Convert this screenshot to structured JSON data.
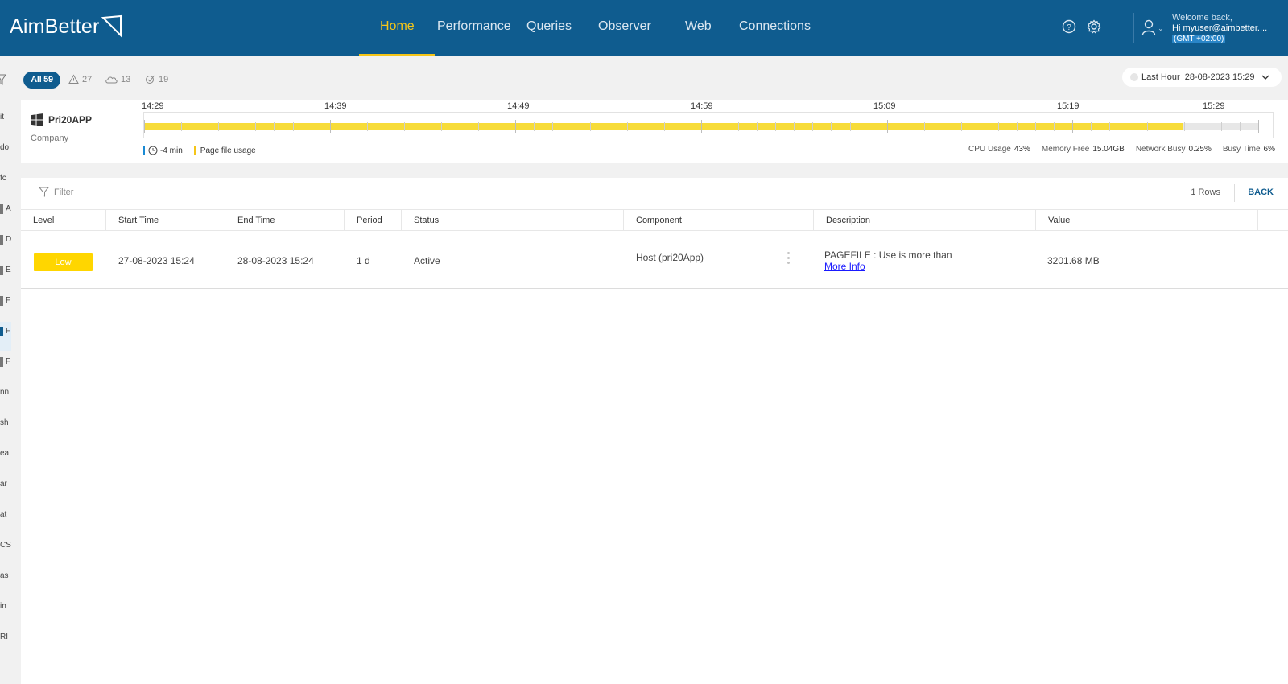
{
  "brand": {
    "name": "AimBetter"
  },
  "nav": {
    "items": [
      {
        "label": "Home",
        "active": true
      },
      {
        "label": "Performance"
      },
      {
        "label": "Queries"
      },
      {
        "label": "Observer"
      },
      {
        "label": "Web"
      },
      {
        "label": "Connections"
      }
    ]
  },
  "user": {
    "welcome": "Welcome back,",
    "greeting": "Hi myuser@aimbetter....",
    "timezone": "(GMT +02:00)"
  },
  "icons": {
    "help": "help-circle-icon",
    "settings": "gear-icon",
    "user": "user-icon",
    "filter": "filter-icon",
    "windows": "windows-logo-icon"
  },
  "left_strip": [
    "it",
    "do",
    "fc",
    "A",
    "D",
    "E",
    "F",
    "F",
    "F",
    "nn",
    "sh",
    "ea",
    "ar",
    "at",
    "CS",
    "as",
    "in",
    "RI"
  ],
  "pills": {
    "all": "All 59",
    "warnings": "27",
    "cloud": "13",
    "resolved": "19"
  },
  "time_range": {
    "label": "Last Hour",
    "value": "28-08-2023 15:29"
  },
  "server": {
    "name": "Pri20APP",
    "company": "Company",
    "timeline_labels": [
      "14:29",
      "14:39",
      "14:49",
      "14:59",
      "15:09",
      "15:19",
      "15:29"
    ],
    "filled_fraction": 0.933,
    "legend_offset": "-4 min",
    "legend_metric": "Page file usage",
    "stats": {
      "cpu_label": "CPU Usage",
      "cpu_value": "43%",
      "memory_label": "Memory Free",
      "memory_value": "15.04GB",
      "network_label": "Network Busy",
      "network_value": "0.25%",
      "busy_label": "Busy Time",
      "busy_value": "6%"
    }
  },
  "table": {
    "filter_placeholder": "Filter",
    "rows_count": "1 Rows",
    "back_label": "BACK",
    "columns": [
      "Level",
      "Start Time",
      "End Time",
      "Period",
      "Status",
      "Component",
      "Description",
      "Value"
    ],
    "rows": [
      {
        "level": "Low",
        "start": "27-08-2023 15:24",
        "end": "28-08-2023 15:24",
        "period": "1 d",
        "status": "Active",
        "component": "Host (pri20App)",
        "description": "PAGEFILE : Use is more than",
        "more_info": "More Info",
        "value": "3201.68 MB"
      }
    ]
  },
  "colors": {
    "header": "#0f5c8f",
    "accent": "#f5c518",
    "low_badge": "#ffd600",
    "timeline_bar": "#f7dc3a",
    "link": "#1a1aff"
  }
}
